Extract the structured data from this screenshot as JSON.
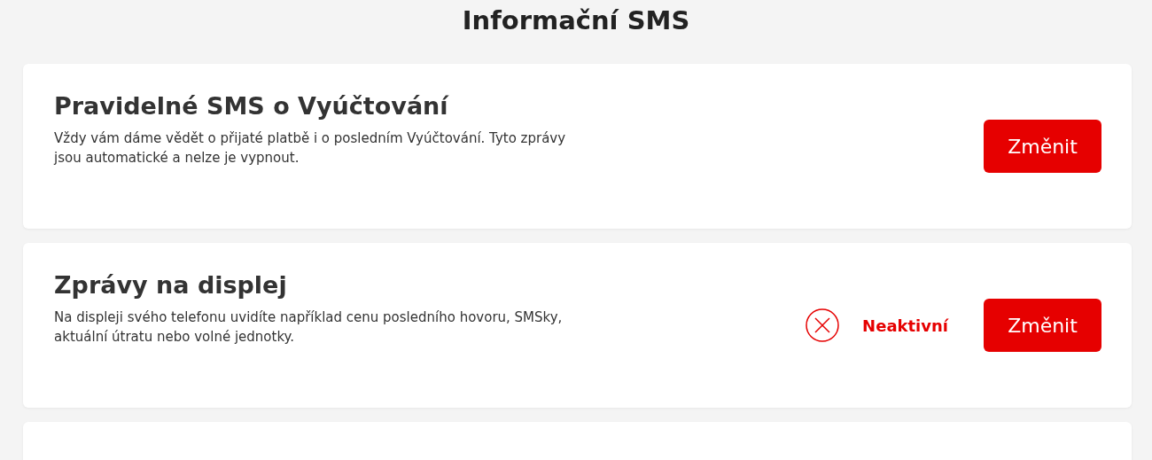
{
  "page": {
    "title": "Informační SMS"
  },
  "cards": [
    {
      "kind": "setting",
      "title": "Pravidelné SMS o Vyúčtování",
      "description": "Vždy vám dáme vědět o přijaté platbě i o posledním Vyúčtování. Tyto zprávy jsou automatické a nelze je vypnout.",
      "button": "Změnit"
    },
    {
      "kind": "setting",
      "title": "Zprávy na displej",
      "description": "Na displeji svého telefonu uvidíte například cenu posledního hovoru, SMSky, aktuální útratu nebo volné jednotky.",
      "status": {
        "label": "Neaktivní",
        "active": false
      },
      "button": "Změnit"
    },
    {
      "kind": "cut"
    }
  ]
}
